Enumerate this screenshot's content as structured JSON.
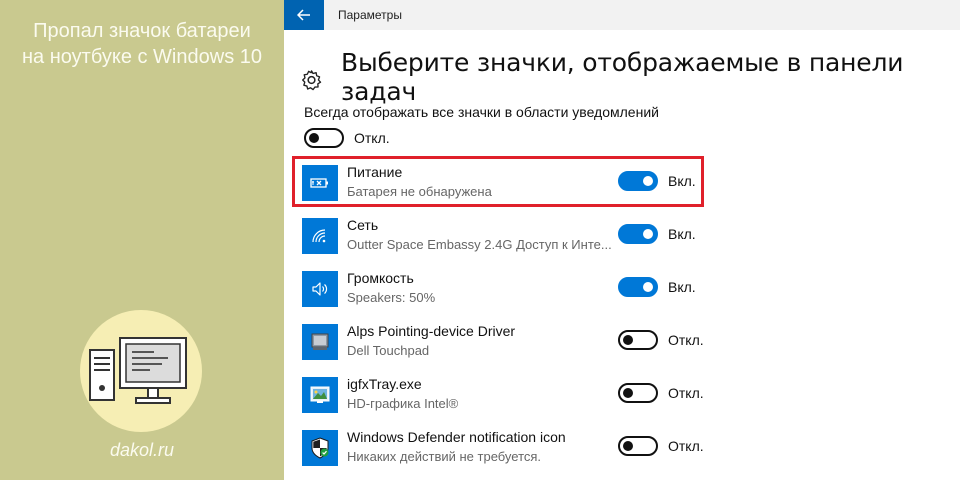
{
  "article": {
    "title_line1": "Пропал значок батареи",
    "title_line2": "на ноутбуке с Windows 10",
    "site": "dakol.ru"
  },
  "window": {
    "title": "Параметры",
    "heading": "Выберите значки, отображаемые в панели задач"
  },
  "always_show": {
    "label": "Всегда отображать все значки в области уведомлений",
    "state": "Откл.",
    "on": false
  },
  "items": [
    {
      "name": "Питание",
      "desc": "Батарея не обнаружена",
      "state": "Вкл.",
      "on": true,
      "icon": "battery-icon"
    },
    {
      "name": "Сеть",
      "desc": "Outter Space Embassy 2.4G Доступ к Инте...",
      "state": "Вкл.",
      "on": true,
      "icon": "wifi-icon"
    },
    {
      "name": "Громкость",
      "desc": "Speakers: 50%",
      "state": "Вкл.",
      "on": true,
      "icon": "speaker-icon"
    },
    {
      "name": "Alps Pointing-device Driver",
      "desc": "Dell Touchpad",
      "state": "Откл.",
      "on": false,
      "icon": "touchpad-icon"
    },
    {
      "name": "igfxTray.exe",
      "desc": "HD-графика Intel®",
      "state": "Откл.",
      "on": false,
      "icon": "intel-graphics-icon"
    },
    {
      "name": "Windows Defender notification icon",
      "desc": "Никаких действий не требуется.",
      "state": "Откл.",
      "on": false,
      "icon": "defender-shield-icon"
    }
  ],
  "colors": {
    "accent": "#0078d7",
    "highlight": "#e0202a",
    "left_panel": "#c9c98f"
  }
}
